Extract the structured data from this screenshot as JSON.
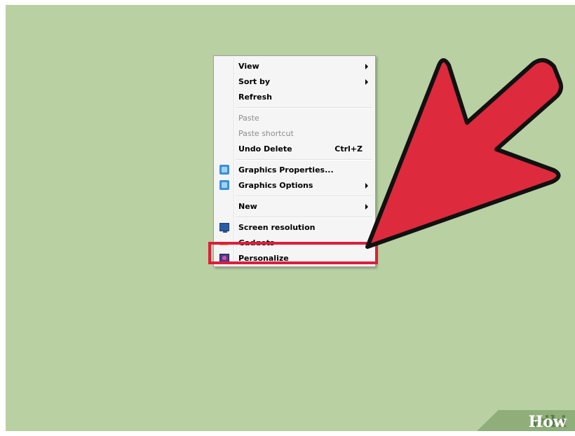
{
  "context_menu": {
    "items": [
      {
        "label": "View",
        "submenu": true
      },
      {
        "label": "Sort by",
        "submenu": true
      },
      {
        "label": "Refresh"
      },
      {
        "label": "Paste",
        "disabled": true
      },
      {
        "label": "Paste shortcut",
        "disabled": true
      },
      {
        "label": "Undo Delete",
        "shortcut": "Ctrl+Z",
        "bold": true
      },
      {
        "label": "Graphics Properties...",
        "icon": "graphics-icon",
        "bold": true
      },
      {
        "label": "Graphics Options",
        "icon": "graphics-icon",
        "submenu": true,
        "bold": true
      },
      {
        "label": "New",
        "submenu": true
      },
      {
        "label": "Screen resolution",
        "icon": "screen-icon",
        "bold": true
      },
      {
        "label": "Gadgets",
        "icon": "gadgets-icon",
        "bold": true
      },
      {
        "label": "Personalize",
        "icon": "personalize-icon",
        "bold": true
      }
    ]
  },
  "annotation": {
    "arrow_color": "#dd2a3c",
    "highlight_color": "#dd1e3a"
  },
  "watermark": {
    "wiki": "wiki",
    "how": "How"
  }
}
